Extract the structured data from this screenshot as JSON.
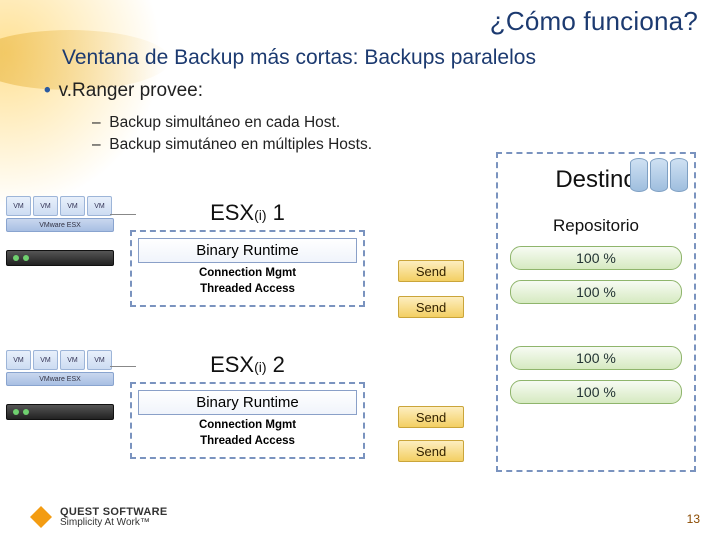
{
  "title": "¿Cómo funciona?",
  "subtitle": "Ventana de  Backup más cortas: Backups paralelos",
  "bullet1": "v.Ranger provee:",
  "subbullet1": "Backup simultáneo en cada Host.",
  "subbullet2": "Backup simutáneo en múltiples Hosts.",
  "vm_label": "VM",
  "esx_bar_label": "VMware ESX",
  "esx": {
    "a": {
      "label": "ESX",
      "sub": "(i)",
      "num": " 1"
    },
    "b": {
      "label": "ESX",
      "sub": "(i)",
      "num": " 2"
    },
    "binary_runtime": "Binary Runtime",
    "conn_mgmt": "Connection Mgmt",
    "threaded": "Threaded Access"
  },
  "send_label": "Send",
  "dest": {
    "title": "Destino",
    "repo": "Repositorio",
    "pct": "100 %"
  },
  "footer": {
    "brand": "QUEST SOFTWARE",
    "tag": "Simplicity At Work™"
  },
  "page_number": "13"
}
